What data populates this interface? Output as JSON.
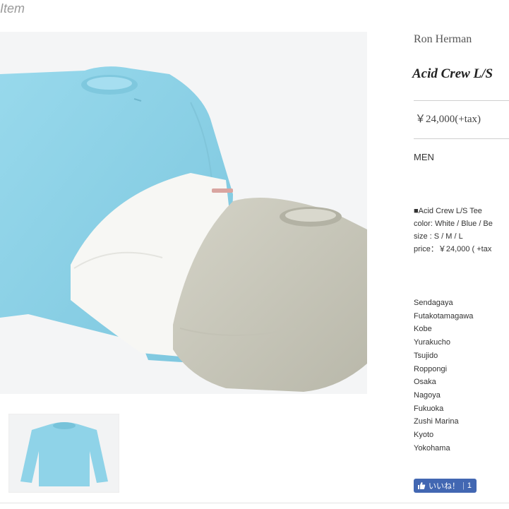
{
  "section": {
    "label": "Item"
  },
  "product": {
    "brand": "Ron Herman",
    "name": "Acid Crew L/S",
    "price": "￥24,000(+tax)",
    "category": "MEN",
    "description": {
      "line1": "■Acid Crew L/S Tee",
      "line2": "color: White / Blue / Be",
      "line3": "size : S / M / L",
      "line4": "price：￥24,000 ( +tax"
    }
  },
  "stores": [
    "Sendagaya",
    "Futakotamagawa",
    "Kobe",
    "Yurakucho",
    "Tsujido",
    "Roppongi",
    "Osaka",
    "Nagoya",
    "Fukuoka",
    "Zushi Marina",
    "Kyoto",
    "Yokohama"
  ],
  "like_button": {
    "label": "いいね！",
    "count": "1"
  },
  "icons": {
    "like": "thumbs-up-icon"
  },
  "colors": {
    "shirt_blue": "#8fd3e8",
    "shirt_white": "#f6f6f3",
    "shirt_beige": "#c9c8bb",
    "facebook_blue": "#4267b2"
  }
}
